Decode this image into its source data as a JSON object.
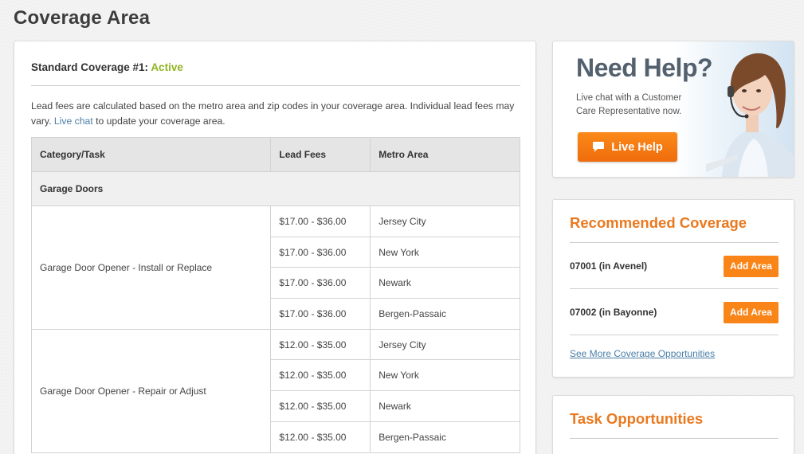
{
  "page": {
    "title": "Coverage Area"
  },
  "coverage": {
    "heading_prefix": "Standard Coverage #1: ",
    "status": "Active",
    "intro_text": "Lead fees are calculated based on the metro area and zip codes in your coverage area. Individual lead fees may vary. ",
    "live_chat_link": "Live chat",
    "intro_suffix": " to update your coverage area."
  },
  "table": {
    "headers": [
      "Category/Task",
      "Lead Fees",
      "Metro Area"
    ],
    "group": "Garage Doors",
    "tasks": [
      {
        "name": "Garage Door Opener - Install or Replace",
        "rows": [
          {
            "fee": "$17.00 - $36.00",
            "metro": "Jersey City"
          },
          {
            "fee": "$17.00 - $36.00",
            "metro": "New York"
          },
          {
            "fee": "$17.00 - $36.00",
            "metro": "Newark"
          },
          {
            "fee": "$17.00 - $36.00",
            "metro": "Bergen-Passaic"
          }
        ]
      },
      {
        "name": "Garage Door Opener - Repair or Adjust",
        "rows": [
          {
            "fee": "$12.00 - $35.00",
            "metro": "Jersey City"
          },
          {
            "fee": "$12.00 - $35.00",
            "metro": "New York"
          },
          {
            "fee": "$12.00 - $35.00",
            "metro": "Newark"
          },
          {
            "fee": "$12.00 - $35.00",
            "metro": "Bergen-Passaic"
          }
        ]
      }
    ]
  },
  "help": {
    "title": "Need Help?",
    "subtitle": "Live chat with a Customer Care Representative now.",
    "button_label": "Live Help"
  },
  "recommended": {
    "title": "Recommended Coverage",
    "items": [
      {
        "label": "07001 (in Avenel)",
        "button": "Add Area"
      },
      {
        "label": "07002 (in Bayonne)",
        "button": "Add Area"
      }
    ],
    "more_link": "See More Coverage Opportunities"
  },
  "tasks": {
    "title": "Task Opportunities"
  },
  "colors": {
    "accent_orange": "#f98417",
    "active_green": "#8fb423",
    "link_blue": "#4a7fa8",
    "heading_orange": "#e9791f"
  }
}
